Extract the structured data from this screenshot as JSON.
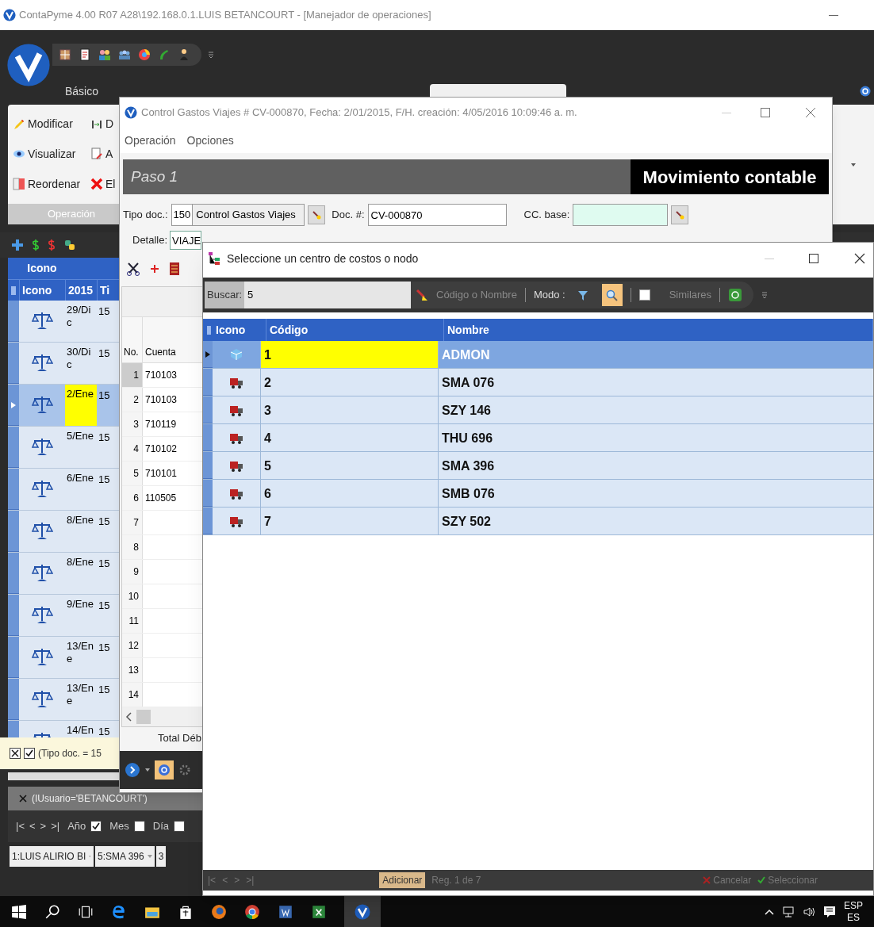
{
  "app": {
    "title": "ContaPyme 4.00 R07 A28\\192.168.0.1.LUIS BETANCOURT - [Manejador de operaciones]",
    "ribbon_tabs": [
      {
        "label": "Básico",
        "selected": false
      }
    ],
    "ribbon_buttons": [
      {
        "label": "Modificar"
      },
      {
        "label": "D"
      },
      {
        "label": "Visualizar"
      },
      {
        "label": "A"
      },
      {
        "label": "Reordenar"
      },
      {
        "label": "El"
      }
    ],
    "ribbon_group": "Operación",
    "grid": {
      "band": "Icono",
      "columns": [
        "Icono",
        "2015",
        "Ti"
      ],
      "rows": [
        {
          "date": "29/Dic",
          "type": "15",
          "selected": false
        },
        {
          "date": "30/Dic",
          "type": "15",
          "selected": false
        },
        {
          "date": "2/Ene",
          "type": "15",
          "selected": true
        },
        {
          "date": "5/Ene",
          "type": "15",
          "selected": false
        },
        {
          "date": "6/Ene",
          "type": "15",
          "selected": false
        },
        {
          "date": "8/Ene",
          "type": "15",
          "selected": false
        },
        {
          "date": "8/Ene",
          "type": "15",
          "selected": false
        },
        {
          "date": "9/Ene",
          "type": "15",
          "selected": false
        },
        {
          "date": "13/Ene",
          "type": "15",
          "selected": false
        },
        {
          "date": "13/Ene",
          "type": "15",
          "selected": false
        },
        {
          "date": "14/En",
          "type": "15",
          "selected": false
        }
      ]
    },
    "filter": {
      "text": "(Tipo doc. = 15",
      "enabled": true
    },
    "user_filter": "(IUsuario='BETANCOURT')",
    "nav": [
      "|<",
      "<",
      ">",
      ">|"
    ],
    "period_checks": [
      {
        "label": "Año",
        "checked": true
      },
      {
        "label": "Mes",
        "checked": false
      },
      {
        "label": "Día",
        "checked": false
      }
    ],
    "combos": [
      "1:LUIS ALIRIO BI",
      "5:SMA 396",
      "3"
    ]
  },
  "document_window": {
    "title": "Control Gastos Viajes # CV-000870, Fecha: 2/01/2015, F/H. creación: 4/05/2016 10:09:46 a. m.",
    "menu": [
      "Operación",
      "Opciones"
    ],
    "step": "Paso 1",
    "heading": "Movimiento contable",
    "tipo_doc": {
      "label": "Tipo doc.:",
      "code": "150",
      "name": "Control Gastos Viajes"
    },
    "doc_number": {
      "label": "Doc. #:",
      "value": "CV-000870"
    },
    "cc_base": {
      "label": "CC. base:"
    },
    "detalle": {
      "label": "Detalle:",
      "value": "VIAJE"
    },
    "lines": {
      "columns": [
        "No.",
        "Cuenta"
      ],
      "rows": [
        {
          "no": "1",
          "account": "710103"
        },
        {
          "no": "2",
          "account": "710103"
        },
        {
          "no": "3",
          "account": "710119"
        },
        {
          "no": "4",
          "account": "710102"
        },
        {
          "no": "5",
          "account": "710101"
        },
        {
          "no": "6",
          "account": "110505"
        },
        {
          "no": "7"
        },
        {
          "no": "8"
        },
        {
          "no": "9"
        },
        {
          "no": "10"
        },
        {
          "no": "11"
        },
        {
          "no": "12"
        },
        {
          "no": "13"
        },
        {
          "no": "14"
        }
      ],
      "total_label": "Total Déb"
    }
  },
  "selector_dialog": {
    "title": "Seleccione un centro de costos o nodo",
    "search": {
      "label": "Buscar:",
      "value": "5"
    },
    "search_by": "Código o Nombre",
    "mode_label": "Modo :",
    "mode_buttons": [
      {
        "selected": false
      },
      {
        "selected": true
      }
    ],
    "similares": {
      "label": "Similares",
      "checked": false
    },
    "columns": [
      "Icono",
      "Código",
      "Nombre"
    ],
    "rows": [
      {
        "kind": "node",
        "code": "1",
        "name": "ADMON",
        "selected": true
      },
      {
        "kind": "vehicle",
        "code": "2",
        "name": "SMA 076",
        "selected": false
      },
      {
        "kind": "vehicle",
        "code": "3",
        "name": "SZY 146",
        "selected": false
      },
      {
        "kind": "vehicle",
        "code": "4",
        "name": "THU 696",
        "selected": false
      },
      {
        "kind": "vehicle",
        "code": "5",
        "name": "SMA 396",
        "selected": false
      },
      {
        "kind": "vehicle",
        "code": "6",
        "name": "SMB 076",
        "selected": false
      },
      {
        "kind": "vehicle",
        "code": "7",
        "name": "SZY 502",
        "selected": false
      }
    ],
    "footer": {
      "nav": [
        "|<",
        "<",
        ">",
        ">|"
      ],
      "add": "Adicionar",
      "record": "Reg. 1 de 7",
      "cancel": "Cancelar",
      "select": "Seleccionar"
    }
  },
  "taskbar": {
    "language": "ESP",
    "layout": "ES"
  }
}
